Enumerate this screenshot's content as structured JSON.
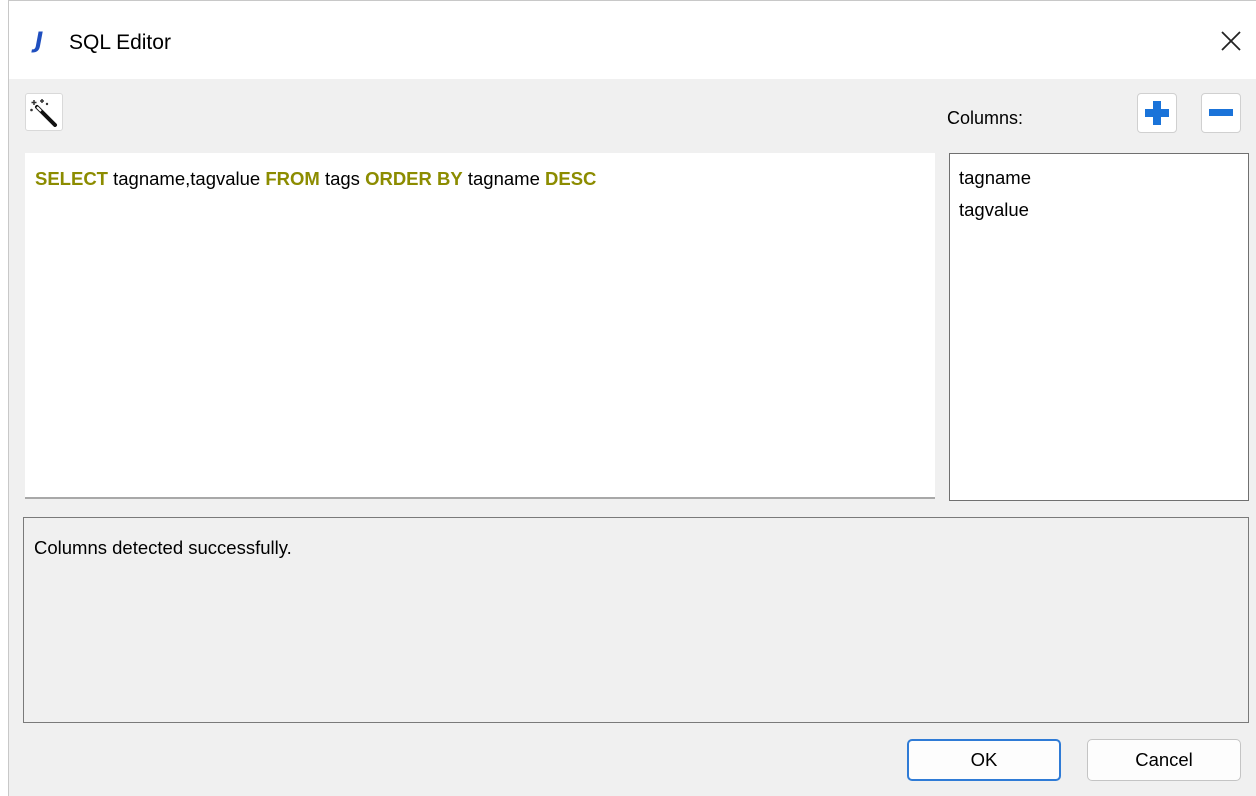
{
  "window": {
    "title": "SQL Editor",
    "app_icon": "J"
  },
  "toolbar": {
    "wand_icon": "magic-wand-icon",
    "columns_label": "Columns:",
    "add_icon": "plus-icon",
    "remove_icon": "minus-icon"
  },
  "editor": {
    "query_tokens": [
      {
        "text": "SELECT",
        "keyword": true
      },
      {
        "text": " tagname,tagvalue ",
        "keyword": false
      },
      {
        "text": "FROM",
        "keyword": true
      },
      {
        "text": " tags ",
        "keyword": false
      },
      {
        "text": "ORDER BY",
        "keyword": true
      },
      {
        "text": " tagname ",
        "keyword": false
      },
      {
        "text": "DESC",
        "keyword": true
      }
    ],
    "keyword_color": "#8c8c00"
  },
  "columns": {
    "items": [
      "tagname",
      "tagvalue"
    ]
  },
  "status": {
    "message": "Columns detected successfully."
  },
  "buttons": {
    "ok_label": "OK",
    "cancel_label": "Cancel"
  },
  "colors": {
    "accent": "#2f7bd6",
    "icon_blue": "#1a73d9"
  }
}
